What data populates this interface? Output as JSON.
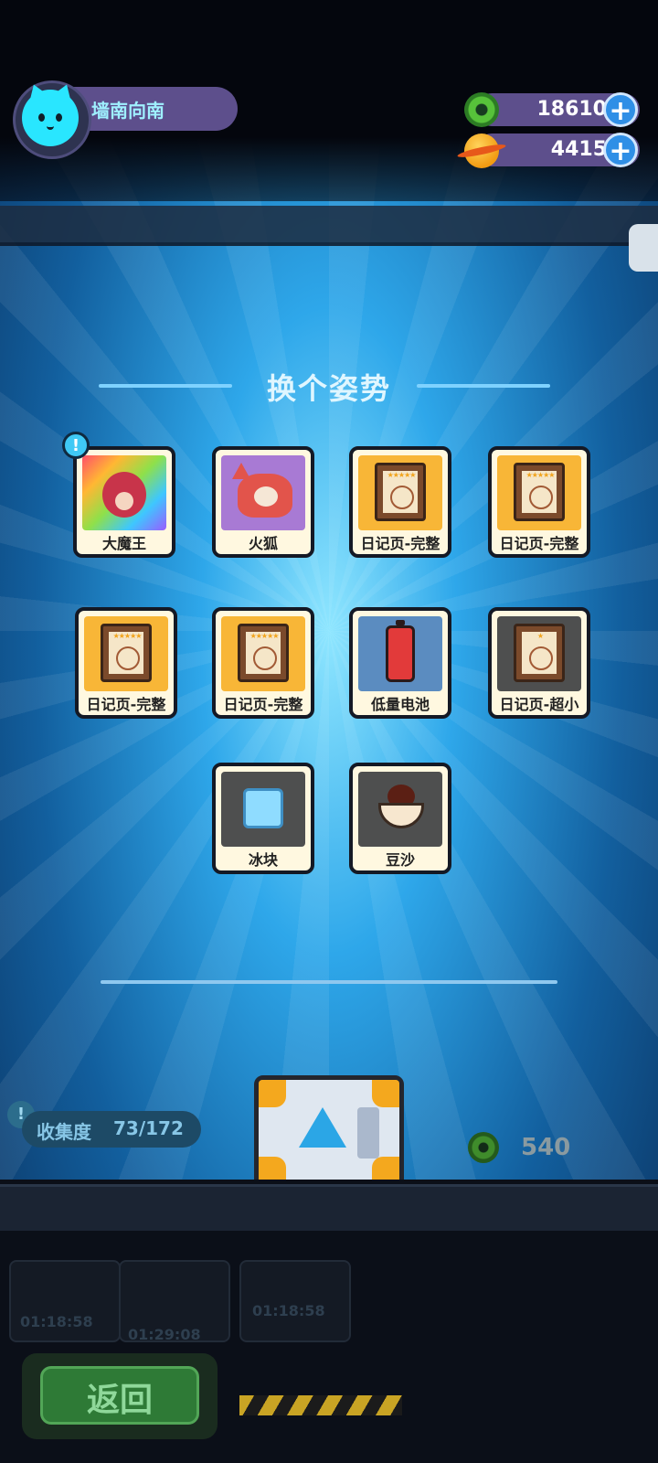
{
  "user": {
    "name": "墙南向南"
  },
  "currencies": [
    {
      "name": "donut-coin",
      "value": "18610"
    },
    {
      "name": "planet-coin",
      "value": "4415"
    }
  ],
  "panel": {
    "title": "换个姿势",
    "items": [
      {
        "label": "大魔王",
        "icon": "demon-king-icon"
      },
      {
        "label": "火狐",
        "icon": "fire-fox-icon"
      },
      {
        "label": "日记页-完整",
        "icon": "diary-page-icon"
      },
      {
        "label": "日记页-完整",
        "icon": "diary-page-icon"
      },
      {
        "label": "日记页-完整",
        "icon": "diary-page-icon"
      },
      {
        "label": "日记页-完整",
        "icon": "diary-page-icon"
      },
      {
        "label": "低量电池",
        "icon": "low-battery-icon"
      },
      {
        "label": "日记页-超小",
        "icon": "diary-page-small-icon"
      },
      {
        "label": "冰块",
        "icon": "ice-cube-icon"
      },
      {
        "label": "豆沙",
        "icon": "bean-paste-icon"
      }
    ]
  },
  "collection": {
    "label": "收集度",
    "value": "73/172"
  },
  "cost": {
    "value": "540"
  },
  "back_button": {
    "label": "返回"
  },
  "timers": [
    "01:18:58",
    "01:29:08",
    "01:18:58"
  ],
  "colors": {
    "accent_blue": "#2ea7ea",
    "pill_purple": "#5d4f8c",
    "chest_orange": "#f4a81e",
    "back_green": "#2e7a36"
  }
}
